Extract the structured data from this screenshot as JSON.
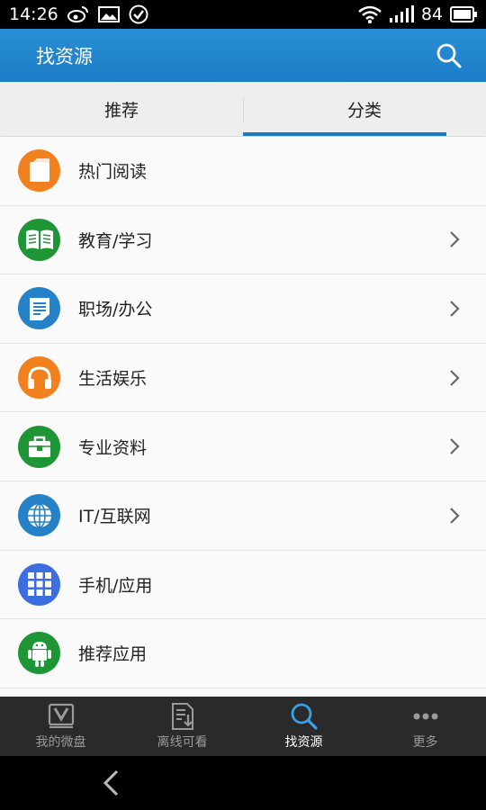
{
  "status_bar": {
    "time": "14:26",
    "battery": "84"
  },
  "header": {
    "title": "找资源"
  },
  "tabs": [
    {
      "label": "推荐"
    },
    {
      "label": "分类"
    }
  ],
  "categories": [
    {
      "label": "热门阅读",
      "icon": "book-icon",
      "color": "#f0811e",
      "has_chevron": false
    },
    {
      "label": "教育/学习",
      "icon": "open-book-icon",
      "color": "#1e9636",
      "has_chevron": true
    },
    {
      "label": "职场/办公",
      "icon": "document-icon",
      "color": "#2582c9",
      "has_chevron": true
    },
    {
      "label": "生活娱乐",
      "icon": "headphones-icon",
      "color": "#f0811e",
      "has_chevron": true
    },
    {
      "label": "专业资料",
      "icon": "briefcase-icon",
      "color": "#1e9636",
      "has_chevron": true
    },
    {
      "label": "IT/互联网",
      "icon": "globe-icon",
      "color": "#2582c9",
      "has_chevron": true
    },
    {
      "label": "手机/应用",
      "icon": "grid-icon",
      "color": "#3d6ee0",
      "has_chevron": false
    },
    {
      "label": "推荐应用",
      "icon": "android-icon",
      "color": "#1e9636",
      "has_chevron": false
    }
  ],
  "bottom_nav": [
    {
      "label": "我的微盘",
      "icon": "vdisk-icon"
    },
    {
      "label": "离线可看",
      "icon": "offline-doc-icon"
    },
    {
      "label": "找资源",
      "icon": "search-icon",
      "active": true
    },
    {
      "label": "更多",
      "icon": "more-dots-icon"
    }
  ]
}
